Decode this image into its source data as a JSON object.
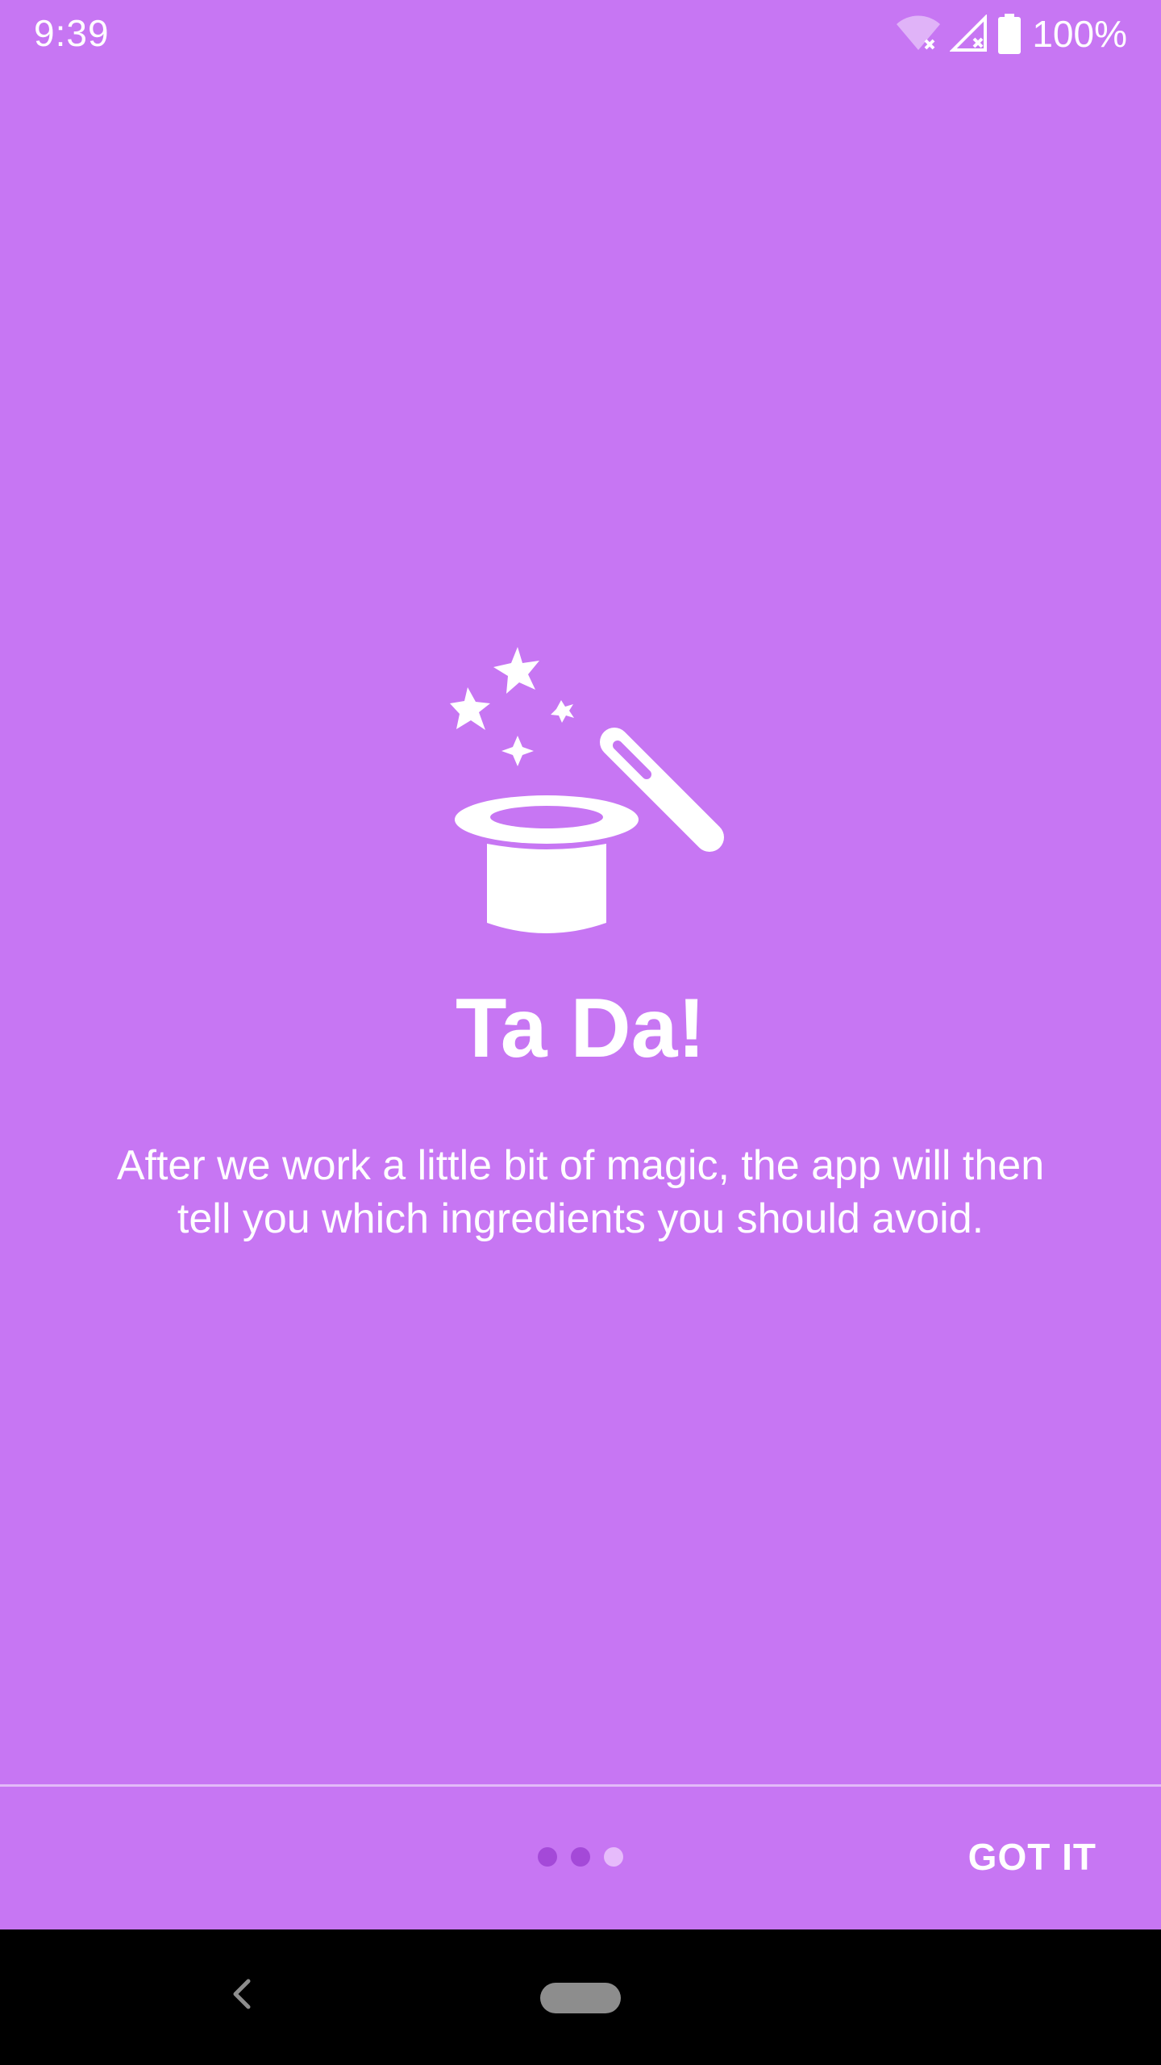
{
  "status_bar": {
    "time": "9:39",
    "battery_percent": "100%",
    "icons": [
      "wifi-off-icon",
      "signal-off-icon",
      "battery-full-icon"
    ]
  },
  "onboarding": {
    "icon": "magic-hat-wand-icon",
    "title": "Ta Da!",
    "description": "After we work a little bit of magic, the app will then tell you which ingredients you should avoid.",
    "pager": {
      "total_pages": 3,
      "current_page": 3
    },
    "got_it_label": "GOT IT"
  },
  "colors": {
    "background": "#c776f3",
    "dot_inactive": "#a449d8",
    "dot_active": "#e6bbfb",
    "system_nav": "#000000"
  },
  "system_nav": {
    "icons": [
      "back-icon",
      "home-pill"
    ]
  }
}
